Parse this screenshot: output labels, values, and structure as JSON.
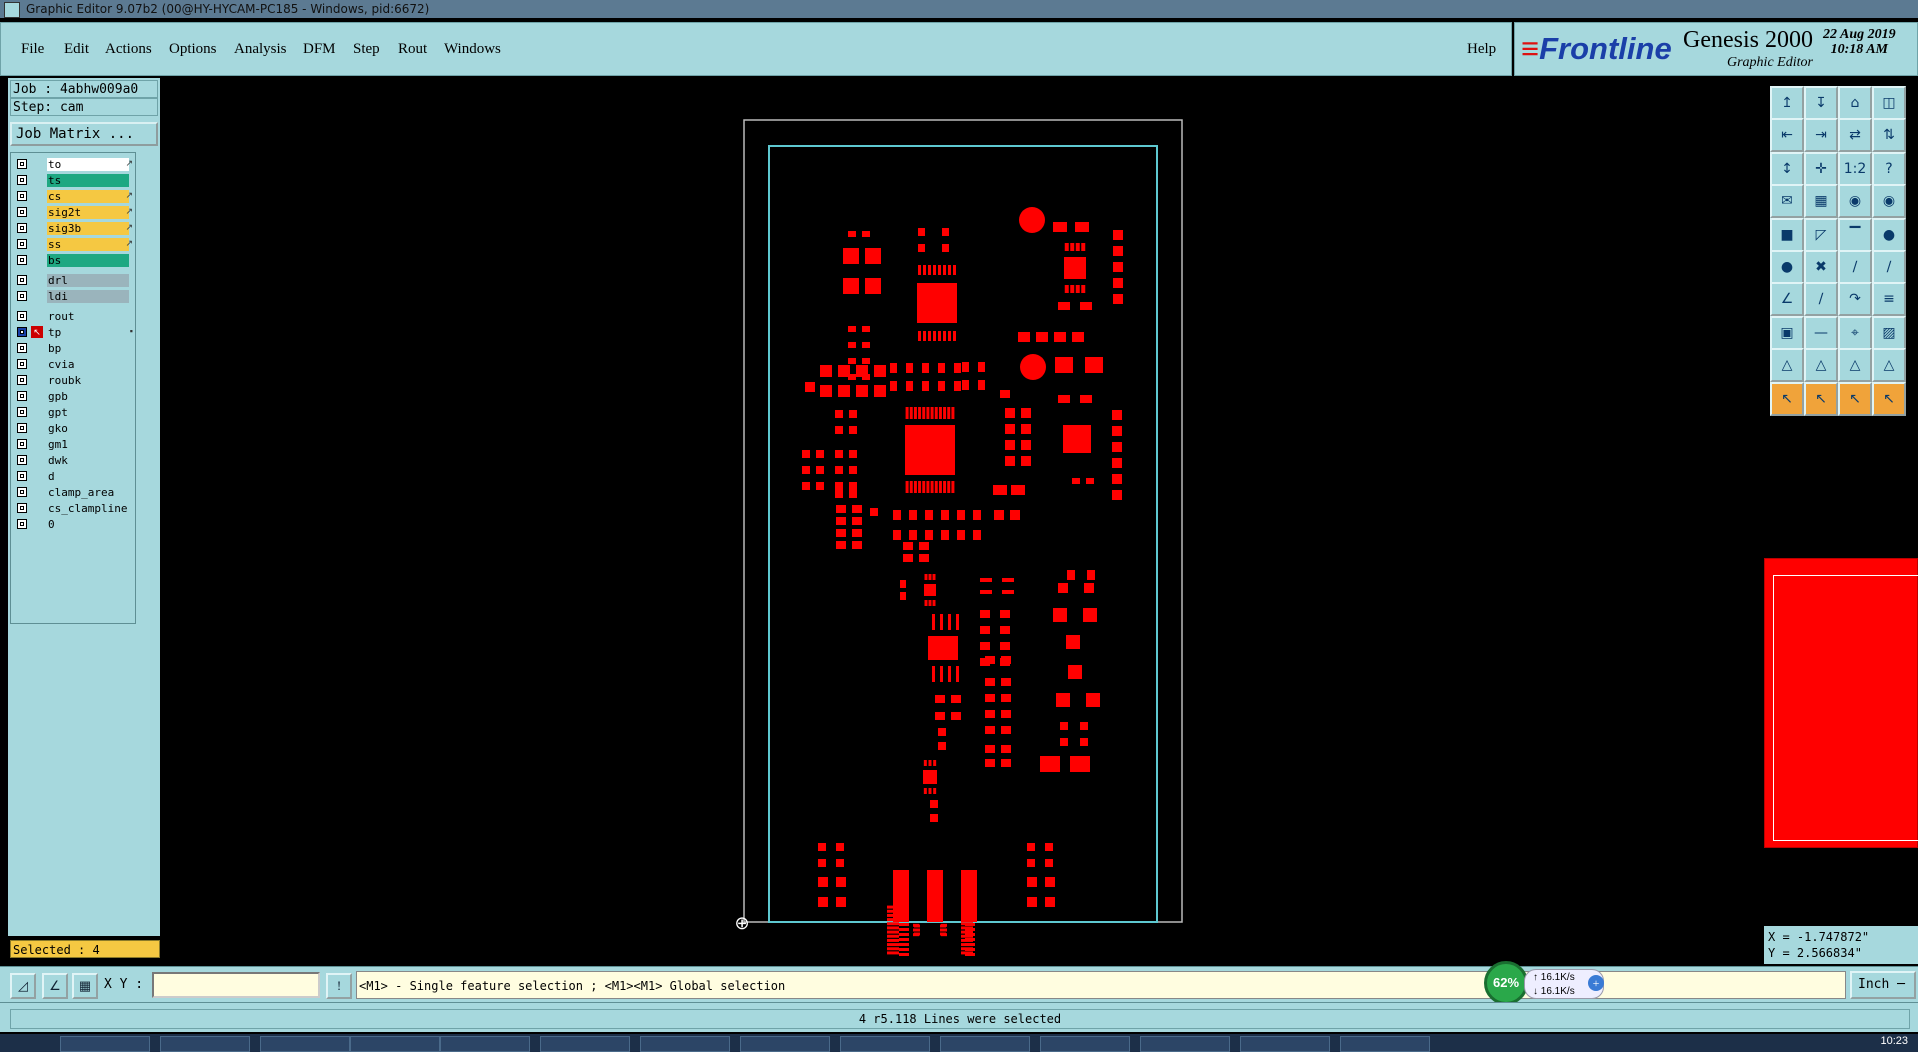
{
  "window": {
    "title": "Graphic Editor 9.07b2 (00@HY-HYCAM-PC185 - Windows, pid:6672)"
  },
  "menu": [
    "File",
    "Edit",
    "Actions",
    "Options",
    "Analysis",
    "DFM",
    "Step",
    "Rout",
    "Windows"
  ],
  "help": "Help",
  "brand": {
    "logo": "Frontline",
    "product": "Genesis 2000",
    "subtitle": "Graphic Editor",
    "date": "22 Aug 2019",
    "time": "10:18 AM"
  },
  "job": {
    "job_label": "Job : 4abhw009a0",
    "step_label": "Step: cam",
    "matrix_button": "Job Matrix ..."
  },
  "layers": [
    {
      "name": "to",
      "color": "#ffffff",
      "tick": "↗"
    },
    {
      "name": "ts",
      "color": "#1ea882",
      "tick": ""
    },
    {
      "name": "cs",
      "color": "#f5c842",
      "tick": "↗"
    },
    {
      "name": "sig2t",
      "color": "#f5c842",
      "tick": "↗"
    },
    {
      "name": "sig3b",
      "color": "#f5c842",
      "tick": "↗"
    },
    {
      "name": "ss",
      "color": "#f5c842",
      "tick": "↗"
    },
    {
      "name": "bs",
      "color": "#1ea882",
      "tick": ""
    },
    {
      "name": "drl",
      "color": "#9ab4bc",
      "tick": ""
    },
    {
      "name": "ldi",
      "color": "#9ab4bc",
      "tick": ""
    },
    {
      "name": "rout",
      "color": "#a6d8dd",
      "tick": ""
    },
    {
      "name": "tp",
      "color": "#a6d8dd",
      "tick": "▪"
    },
    {
      "name": "bp",
      "color": "#a6d8dd",
      "tick": ""
    },
    {
      "name": "cvia",
      "color": "#a6d8dd",
      "tick": ""
    },
    {
      "name": "roubk",
      "color": "#a6d8dd",
      "tick": ""
    },
    {
      "name": "gpb",
      "color": "#a6d8dd",
      "tick": ""
    },
    {
      "name": "gpt",
      "color": "#a6d8dd",
      "tick": ""
    },
    {
      "name": "gko",
      "color": "#a6d8dd",
      "tick": ""
    },
    {
      "name": "gm1",
      "color": "#a6d8dd",
      "tick": ""
    },
    {
      "name": "dwk",
      "color": "#a6d8dd",
      "tick": ""
    },
    {
      "name": "d",
      "color": "#a6d8dd",
      "tick": ""
    },
    {
      "name": "clamp_area",
      "color": "#a6d8dd",
      "tick": ""
    },
    {
      "name": "cs_clampline",
      "color": "#a6d8dd",
      "tick": ""
    },
    {
      "name": "0",
      "color": "#a6d8dd",
      "tick": ""
    }
  ],
  "selected_label": "Selected : 4",
  "tools": [
    [
      "↥",
      "↧",
      "⌂",
      "◫"
    ],
    [
      "⇤",
      "⇥",
      "⇄",
      "⇅"
    ],
    [
      "↕",
      "✛",
      "1:2",
      "?"
    ],
    [
      "✉",
      "▦",
      "◉",
      "◉"
    ],
    [
      "■",
      "◸",
      "▔",
      "●"
    ],
    [
      "●",
      "✖",
      "∕",
      "∕"
    ],
    [
      "∠",
      "∕",
      "↷",
      "≡"
    ],
    [
      "▣",
      "—",
      "⌖",
      "▨"
    ],
    [
      "△",
      "△",
      "△",
      "△"
    ],
    [
      "↖",
      "↖",
      "↖",
      "↖"
    ]
  ],
  "coords": {
    "x": "X = -1.747872\"",
    "y": "Y = 2.566834\""
  },
  "bottom": {
    "xy_label": "X Y :",
    "xy_value": "",
    "hint": "<M1> - Single feature selection ; <M1><M1> Global selection",
    "unit": "Inch",
    "status": "4 r5.118 Lines were selected"
  },
  "net": {
    "percent": "62%",
    "up": "16.1K/s",
    "down": "16.1K/s"
  },
  "taskbar_clock": "10:23",
  "colors": {
    "panel": "#a6d8dd",
    "feature": "#ff0000",
    "profile": "#5ec8d0"
  }
}
